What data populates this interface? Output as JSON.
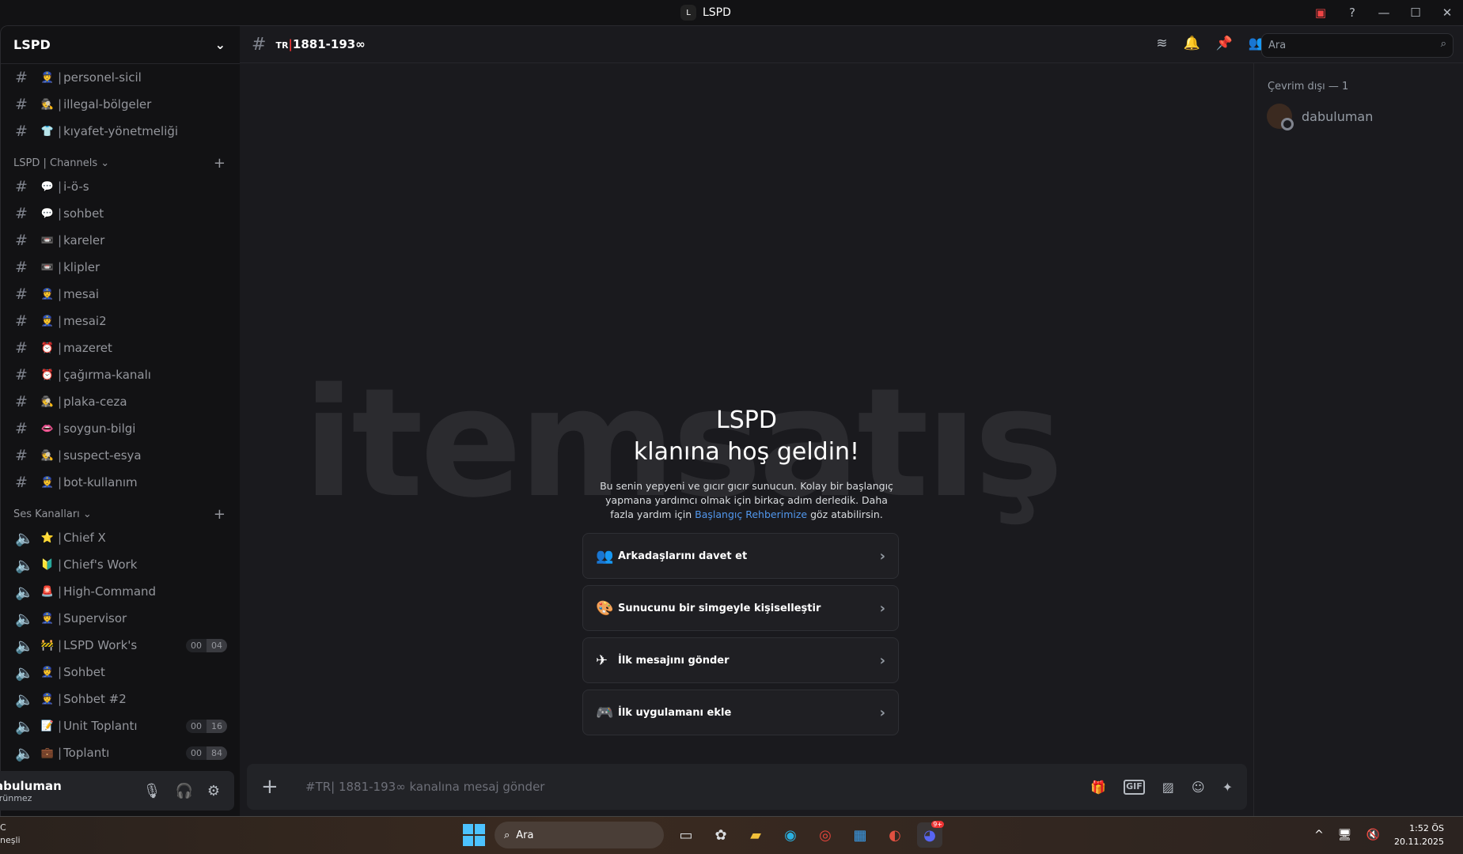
{
  "window": {
    "title": "LSPD",
    "logo_letter": "L"
  },
  "server": {
    "name": "LSPD"
  },
  "top_channels": [
    {
      "emoji": "👮",
      "name": "personel-sicil"
    },
    {
      "emoji": "🕵",
      "name": "illegal-bölgeler"
    },
    {
      "emoji": "👕",
      "name": "kıyafet-yönetmeliği"
    }
  ],
  "categories": [
    {
      "label": "LSPD | Channels ⌄",
      "channels": [
        {
          "emoji": "💬",
          "name": "i-ö-s"
        },
        {
          "emoji": "💬",
          "name": "sohbet"
        },
        {
          "emoji": "📼",
          "name": "kareler"
        },
        {
          "emoji": "📼",
          "name": "klipler"
        },
        {
          "emoji": "👮",
          "name": "mesai"
        },
        {
          "emoji": "👮",
          "name": "mesai2"
        },
        {
          "emoji": "⏰",
          "name": "mazeret"
        },
        {
          "emoji": "⏰",
          "name": "çağırma-kanalı"
        },
        {
          "emoji": "🕵",
          "name": "plaka-ceza"
        },
        {
          "emoji": "👄",
          "name": "soygun-bilgi"
        },
        {
          "emoji": "🕵",
          "name": "suspect-esya"
        },
        {
          "emoji": "👮",
          "name": "bot-kullanım"
        }
      ]
    },
    {
      "label": "Ses Kanalları ⌄",
      "voice": true,
      "channels": [
        {
          "emoji": "⭐",
          "name": "Chief X"
        },
        {
          "emoji": "🔰",
          "name": "Chief's Work"
        },
        {
          "emoji": "🚨",
          "name": "High-Command"
        },
        {
          "emoji": "👮",
          "name": "Supervisor"
        },
        {
          "emoji": "🚧",
          "name": "LSPD Work's",
          "counts": [
            "00",
            "04"
          ]
        },
        {
          "emoji": "👮",
          "name": "Sohbet"
        },
        {
          "emoji": "👮",
          "name": "Sohbet #2"
        },
        {
          "emoji": "📝",
          "name": "Unit Toplantı",
          "counts": [
            "00",
            "16"
          ]
        },
        {
          "emoji": "💼",
          "name": "Toplantı",
          "counts": [
            "00",
            "84"
          ]
        }
      ]
    }
  ],
  "user": {
    "name": "abuluman",
    "status": "örünmez"
  },
  "channel": {
    "prefix": "TR",
    "name": "1881-193∞"
  },
  "search": {
    "placeholder": "Ara"
  },
  "members": {
    "header": "Çevrim dışı — 1",
    "items": [
      {
        "name": "dabuluman"
      }
    ]
  },
  "watermark": "itemsatış",
  "welcome": {
    "title1": "LSPD",
    "title2": "klanına hoş geldin!",
    "desc1": "Bu senin yepyeni ve gıcır gıcır sunucun. Kolay bir başlangıç yapmana yardımcı olmak için birkaç adım derledik. Daha fazla yardım için ",
    "link": "Başlangıç Rehberimize",
    "desc2": " göz atabilirsin.",
    "cards": [
      {
        "icon": "👥",
        "label": "Arkadaşlarını davet et"
      },
      {
        "icon": "🎨",
        "label": "Sunucunu bir simgeyle kişiselleştir"
      },
      {
        "icon": "✈",
        "label": "İlk mesajını gönder"
      },
      {
        "icon": "🎮",
        "label": "İlk uygulamanı ekle"
      }
    ]
  },
  "composer": {
    "placeholder": "#TR| 1881-193∞ kanalına mesaj gönder"
  },
  "taskbar": {
    "weather1": "C",
    "weather2": "neşli",
    "search": "Ara",
    "time": "1:52 ÖS",
    "date": "20.11.2025",
    "discord_badge": "9+"
  }
}
